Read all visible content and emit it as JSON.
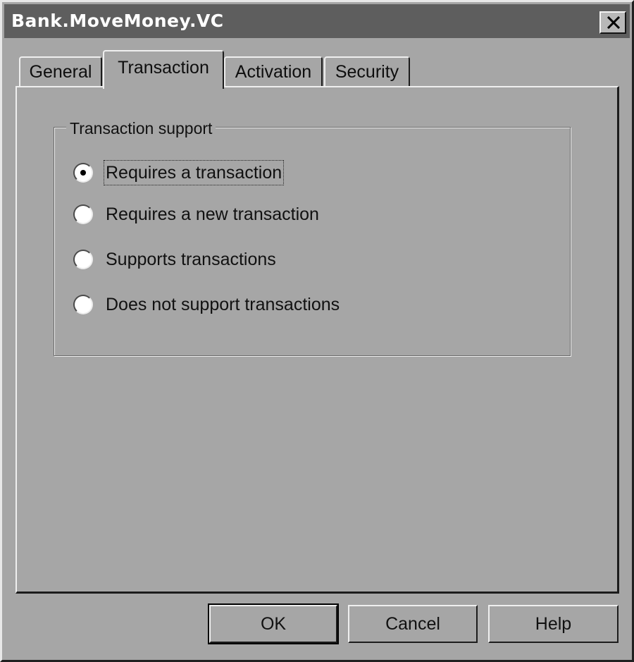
{
  "window": {
    "title": "Bank.MoveMoney.VC"
  },
  "tabs": [
    {
      "label": "General",
      "selected": false
    },
    {
      "label": "Transaction",
      "selected": true
    },
    {
      "label": "Activation",
      "selected": false
    },
    {
      "label": "Security",
      "selected": false
    }
  ],
  "transaction_support": {
    "title": "Transaction support",
    "options": [
      {
        "label": "Requires a transaction",
        "selected": true
      },
      {
        "label": "Requires a new transaction",
        "selected": false
      },
      {
        "label": "Supports transactions",
        "selected": false
      },
      {
        "label": "Does not support transactions",
        "selected": false
      }
    ]
  },
  "buttons": {
    "ok": "OK",
    "cancel": "Cancel",
    "help": "Help"
  },
  "icons": {
    "close": "close-icon"
  },
  "colors": {
    "face": "#a6a6a6",
    "titlebar": "#5e5e5e"
  }
}
